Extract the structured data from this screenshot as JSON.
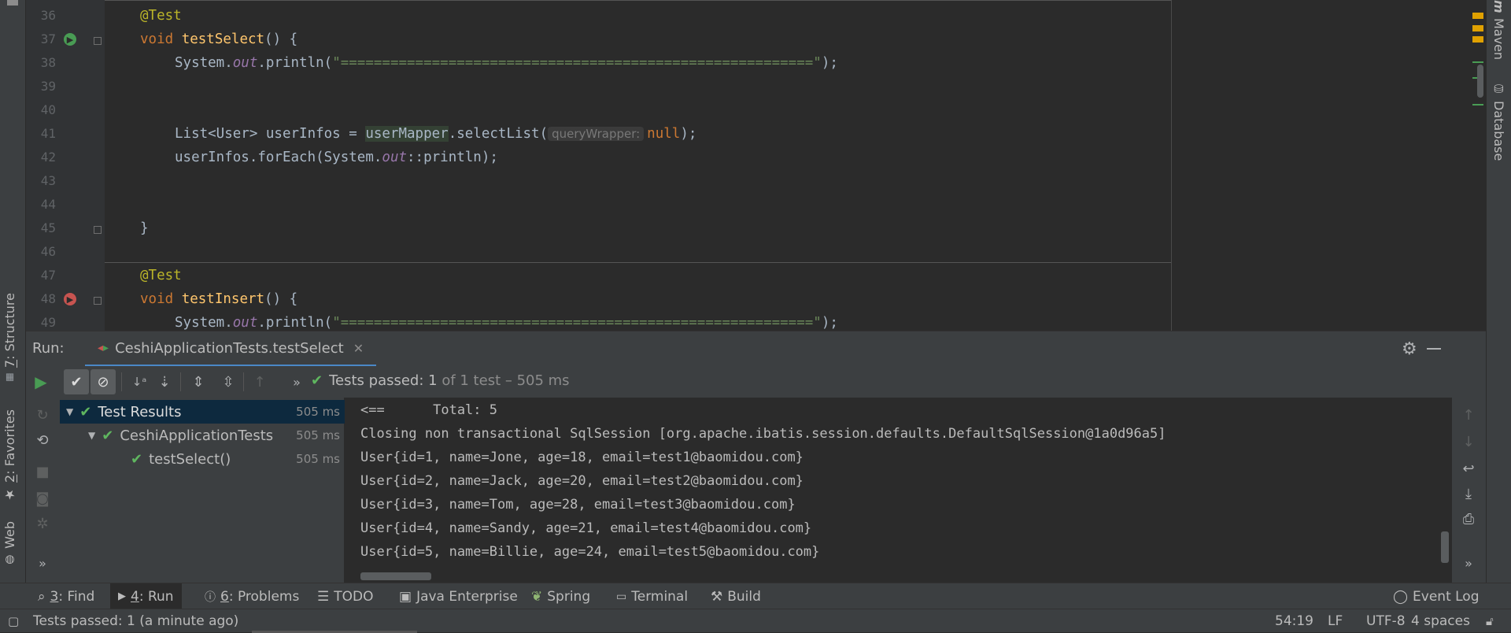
{
  "left_stripe": {
    "structure": {
      "num": "7",
      "label": ": Structure"
    },
    "favorites": {
      "num": "2",
      "label": ": Favorites"
    },
    "web": "Web"
  },
  "right_stripe": {
    "maven": "Maven",
    "database": "Database"
  },
  "editor": {
    "lines": [
      {
        "n": "36"
      },
      {
        "n": "37"
      },
      {
        "n": "38"
      },
      {
        "n": "39"
      },
      {
        "n": "40"
      },
      {
        "n": "41"
      },
      {
        "n": "42"
      },
      {
        "n": "43"
      },
      {
        "n": "44"
      },
      {
        "n": "45"
      },
      {
        "n": "46"
      },
      {
        "n": "47"
      },
      {
        "n": "48"
      },
      {
        "n": "49"
      }
    ],
    "l36_ann": "@Test",
    "l37_void": "void ",
    "l37_fn": "testSelect",
    "l37_rest": "() {",
    "l38_pre": "System.",
    "l38_out": "out",
    "l38_mid": ".println(",
    "l38_str": "\"=========================================================\"",
    "l38_end": ");",
    "l41_pre": "List<User> userInfos = ",
    "l41_mapper": "userMapper",
    "l41_mid": ".selectList(",
    "l41_hint": "queryWrapper:",
    "l41_null": "null",
    "l41_end": ");",
    "l42_pre": "userInfos.forEach(System.",
    "l42_out": "out",
    "l42_end": "::println);",
    "l45_brace": "}",
    "l47_ann": "@Test",
    "l48_void": "void ",
    "l48_fn": "testInsert",
    "l48_rest": "() {",
    "l49_pre": "System.",
    "l49_out": "out",
    "l49_mid": ".println(",
    "l49_str": "\"=========================================================\"",
    "l49_end": ");"
  },
  "run": {
    "label": "Run:",
    "tab_title": "CeshiApplicationTests.testSelect",
    "status_strong": "Tests passed: 1",
    "status_rest": " of 1 test – 505 ms"
  },
  "tree": [
    {
      "label": "Test Results",
      "time": "505 ms"
    },
    {
      "label": "CeshiApplicationTests",
      "time": "505 ms"
    },
    {
      "label": "testSelect()",
      "time": "505 ms"
    }
  ],
  "console": [
    "<==      Total: 5",
    "Closing non transactional SqlSession [org.apache.ibatis.session.defaults.DefaultSqlSession@1a0d96a5]",
    "User{id=1, name=Jone, age=18, email=test1@baomidou.com}",
    "User{id=2, name=Jack, age=20, email=test2@baomidou.com}",
    "User{id=3, name=Tom, age=28, email=test3@baomidou.com}",
    "User{id=4, name=Sandy, age=21, email=test4@baomidou.com}",
    "User{id=5, name=Billie, age=24, email=test5@baomidou.com}"
  ],
  "tool_tabs": {
    "find_num": "3",
    "find_label": ": Find",
    "run_num": "4",
    "run_label": ": Run",
    "problems_num": "6",
    "problems_label": ": Problems",
    "todo": "TODO",
    "java_enterprise": "Java Enterprise",
    "spring": "Spring",
    "terminal": "Terminal",
    "build": "Build",
    "event_log": "Event Log"
  },
  "status": {
    "message": "Tests passed: 1 (a minute ago)",
    "position": "54:19",
    "line_sep": "LF",
    "encoding": "UTF-8",
    "indent": "4 spaces"
  },
  "colors": {
    "accent_green": "#5fb65f",
    "background": "#2b2b2b",
    "panel": "#3c3f41"
  }
}
